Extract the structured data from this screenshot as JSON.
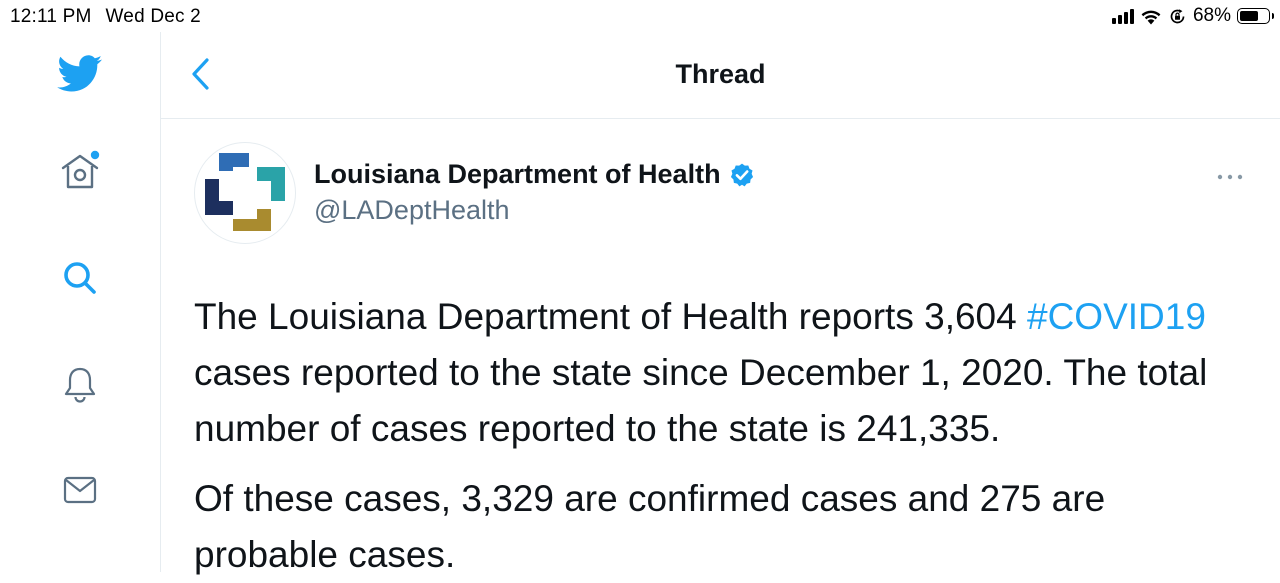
{
  "status_bar": {
    "time": "12:11 PM",
    "date": "Wed Dec 2",
    "battery_percent": "68%",
    "battery_level": 0.68
  },
  "sidebar": {
    "items": [
      {
        "name": "twitter-logo-icon"
      },
      {
        "name": "home-icon",
        "has_notification_dot": true
      },
      {
        "name": "search-icon"
      },
      {
        "name": "notifications-icon"
      },
      {
        "name": "messages-icon"
      }
    ]
  },
  "header": {
    "title": "Thread",
    "back_icon": "chevron-left-icon"
  },
  "tweet": {
    "author_name": "Louisiana Department of Health",
    "verified": true,
    "author_handle": "@LADeptHealth",
    "more_icon": "more-options-icon",
    "paragraph1_before_hashtag": "The Louisiana Department of Health reports 3,604 ",
    "hashtag": "#COVID19",
    "paragraph1_after_hashtag": " cases reported to the state since December 1, 2020. The total number of cases reported to the state is 241,335.",
    "paragraph2": "Of these cases, 3,329 are confirmed cases and 275 are probable cases."
  },
  "colors": {
    "accent": "#1da1f2",
    "text": "#0f1419",
    "secondary_text": "#5b7083",
    "divider": "#e6ecf0",
    "logo_blue": "#2f6db5",
    "logo_teal": "#2aa3a8",
    "logo_navy": "#1d2f5e",
    "logo_gold": "#a98b2f"
  }
}
